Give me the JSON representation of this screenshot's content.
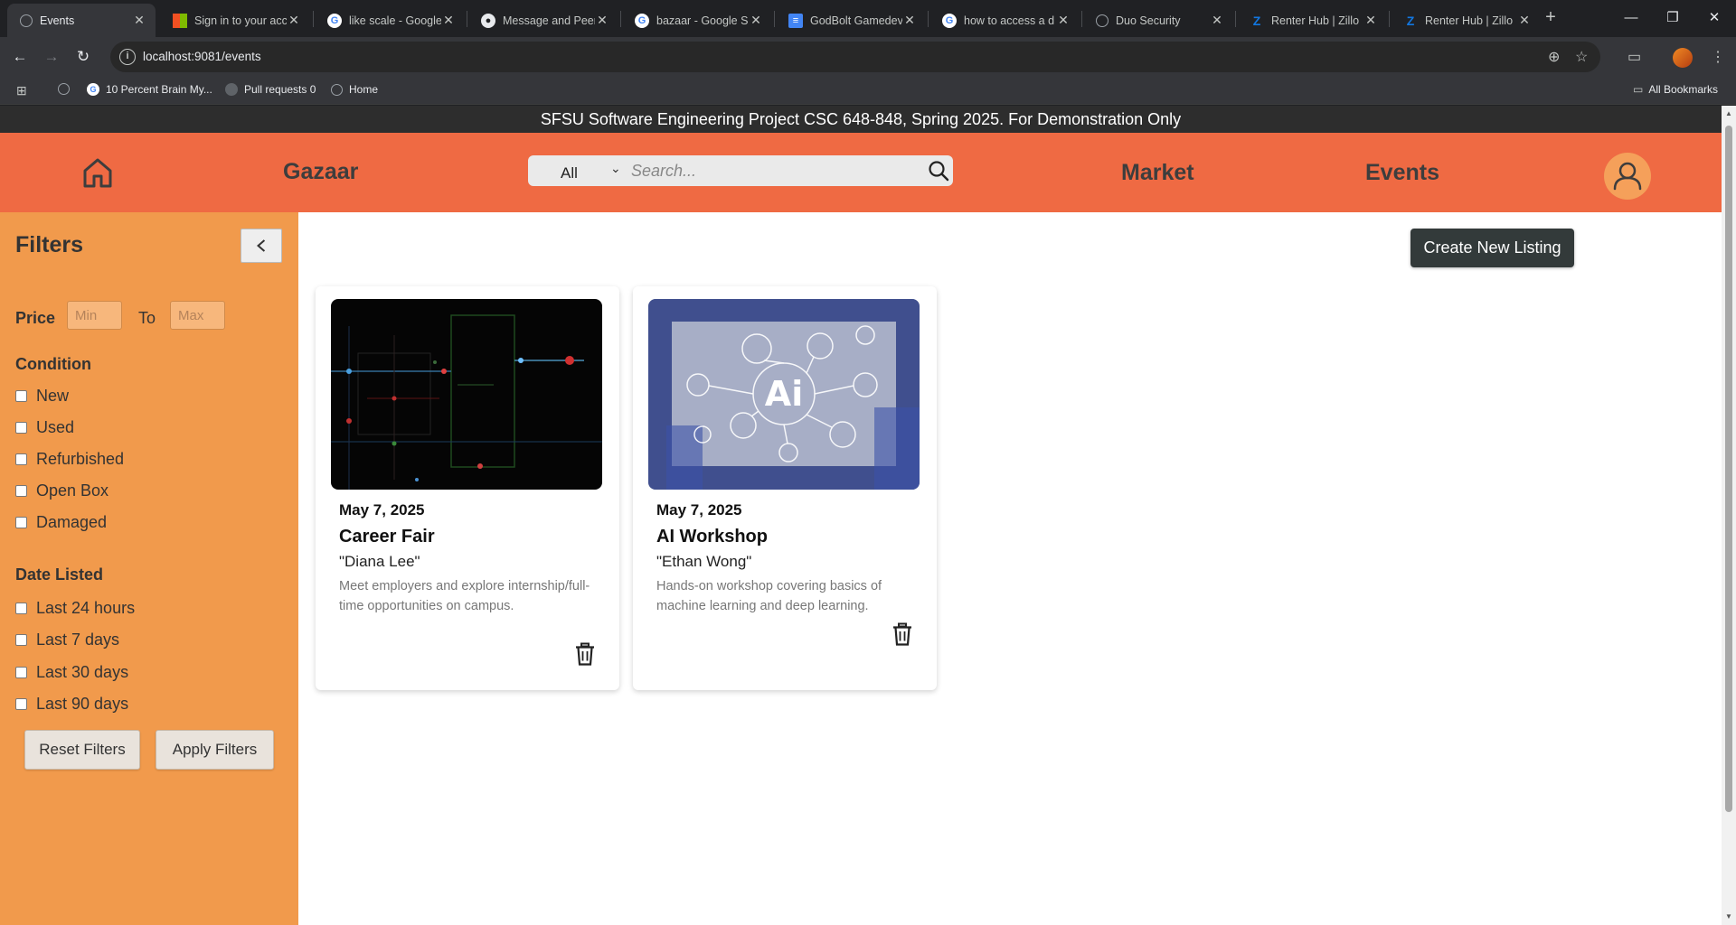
{
  "browser": {
    "tabs": [
      {
        "title": "Events",
        "icon": "globe-icon",
        "active": true
      },
      {
        "title": "Sign in to your acc",
        "icon": "microsoft-icon"
      },
      {
        "title": "like scale - Google",
        "icon": "google-icon"
      },
      {
        "title": "Message and Peer",
        "icon": "github-icon"
      },
      {
        "title": "bazaar - Google S",
        "icon": "google-icon"
      },
      {
        "title": "GodBolt Gamedev",
        "icon": "docs-icon"
      },
      {
        "title": "how to access a d",
        "icon": "google-icon"
      },
      {
        "title": "Duo Security",
        "icon": "globe-icon"
      },
      {
        "title": "Renter Hub | Zillo",
        "icon": "zillow-icon"
      },
      {
        "title": "Renter Hub | Zillo",
        "icon": "zillow-icon"
      }
    ],
    "url": "localhost:9081/events",
    "bookmarks": [
      {
        "label": "10 Percent Brain My...",
        "icon": "google-icon"
      },
      {
        "label": "Pull requests 0",
        "icon": "github-icon"
      },
      {
        "label": "Home",
        "icon": "globe-icon"
      }
    ],
    "all_bookmarks": "All Bookmarks"
  },
  "banner": "SFSU Software Engineering Project CSC 648-848, Spring 2025. For Demonstration Only",
  "header": {
    "brand": "Gazaar",
    "search_category": "All",
    "search_placeholder": "Search...",
    "nav": {
      "market": "Market",
      "events": "Events"
    }
  },
  "filters": {
    "title": "Filters",
    "price_label": "Price",
    "min_placeholder": "Min",
    "to_label": "To",
    "max_placeholder": "Max",
    "condition": {
      "title": "Condition",
      "options": [
        "New",
        "Used",
        "Refurbished",
        "Open Box",
        "Damaged"
      ]
    },
    "date_listed": {
      "title": "Date Listed",
      "options": [
        "Last 24 hours",
        "Last 7 days",
        "Last 30 days",
        "Last 90 days"
      ]
    },
    "reset_label": "Reset Filters",
    "apply_label": "Apply Filters"
  },
  "create_listing_label": "Create New Listing",
  "events": [
    {
      "date": "May 7, 2025",
      "title": "Career Fair",
      "host": "\"Diana Lee\"",
      "description": "Meet employers and explore internship/full-time opportunities on campus.",
      "image": "circuit-board-image"
    },
    {
      "date": "May 7, 2025",
      "title": "AI Workshop",
      "host": "\"Ethan Wong\"",
      "description": "Hands-on workshop covering basics of machine learning and deep learning.",
      "image": "ai-network-image"
    }
  ],
  "colors": {
    "header": "#ef6a43",
    "sidebar": "#f19a4c",
    "banner": "#2d2d2d",
    "create_button": "#333a3a"
  }
}
